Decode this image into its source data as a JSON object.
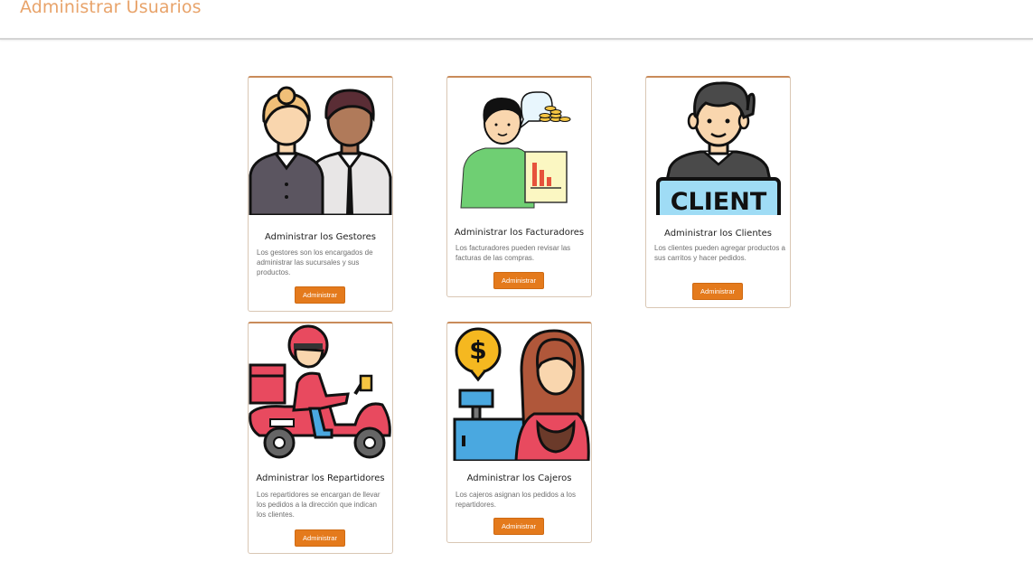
{
  "header": {
    "title": "Administrar Usuarios"
  },
  "cards": [
    {
      "title": "Administrar los Gestores",
      "description": "Los gestores son los encargados de administrar las sucursales y sus productos.",
      "button": "Administrar",
      "image": "managers-illustration"
    },
    {
      "title": "Administrar los Facturadores",
      "description": "Los facturadores pueden revisar las facturas de las compras.",
      "button": "Administrar",
      "image": "billing-person-illustration"
    },
    {
      "title": "Administrar los Clientes",
      "description": "Los clientes pueden agregar productos a sus carritos y hacer pedidos.",
      "button": "Administrar",
      "image": "client-sign-illustration",
      "sign_text": "CLIENT"
    },
    {
      "title": "Administrar los Repartidores",
      "description": "Los repartidores se encargan de llevar los pedidos a la dirección que indican los clientes.",
      "button": "Administrar",
      "image": "delivery-scooter-illustration"
    },
    {
      "title": "Administrar los Cajeros",
      "description": "Los cajeros asignan los pedidos a los repartidores.",
      "button": "Administrar",
      "image": "cashier-illustration",
      "sign_text": "$"
    }
  ]
}
